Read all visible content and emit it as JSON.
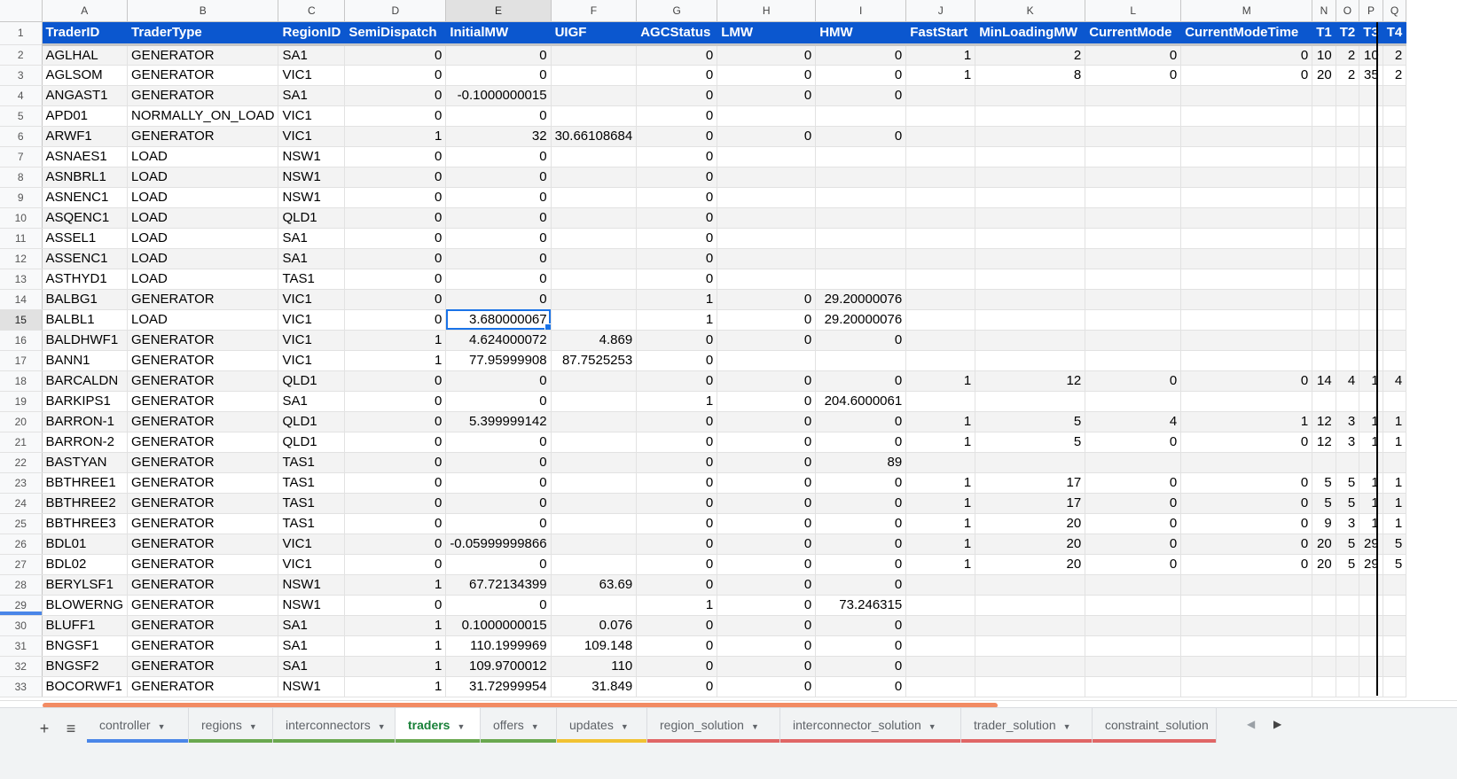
{
  "columns": {
    "letters": [
      "A",
      "B",
      "C",
      "D",
      "E",
      "F",
      "G",
      "H",
      "I",
      "J",
      "K",
      "L",
      "M",
      "N",
      "O",
      "P",
      "Q"
    ],
    "selected": "E"
  },
  "headers": [
    "TraderID",
    "TraderType",
    "RegionID",
    "SemiDispatch",
    "InitialMW",
    "UIGF",
    "AGCStatus",
    "LMW",
    "HMW",
    "FastStart",
    "MinLoadingMW",
    "CurrentMode",
    "CurrentModeTime",
    "T1",
    "T2",
    "T3",
    "T4"
  ],
  "header_row_number": "1",
  "rows": [
    {
      "num": "2",
      "cells": [
        "AGLHAL",
        "GENERATOR",
        "SA1",
        "0",
        "0",
        "",
        "0",
        "0",
        "0",
        "1",
        "2",
        "0",
        "0",
        "10",
        "2",
        "10",
        "2"
      ]
    },
    {
      "num": "3",
      "cells": [
        "AGLSOM",
        "GENERATOR",
        "VIC1",
        "0",
        "0",
        "",
        "0",
        "0",
        "0",
        "1",
        "8",
        "0",
        "0",
        "20",
        "2",
        "35",
        "2"
      ]
    },
    {
      "num": "4",
      "cells": [
        "ANGAST1",
        "GENERATOR",
        "SA1",
        "0",
        "-0.1000000015",
        "",
        "0",
        "0",
        "0",
        "",
        "",
        "",
        "",
        "",
        "",
        "",
        ""
      ]
    },
    {
      "num": "5",
      "cells": [
        "APD01",
        "NORMALLY_ON_LOAD",
        "VIC1",
        "0",
        "0",
        "",
        "0",
        "",
        "",
        "",
        "",
        "",
        "",
        "",
        "",
        "",
        ""
      ]
    },
    {
      "num": "6",
      "cells": [
        "ARWF1",
        "GENERATOR",
        "VIC1",
        "1",
        "32",
        "30.66108684",
        "0",
        "0",
        "0",
        "",
        "",
        "",
        "",
        "",
        "",
        "",
        ""
      ]
    },
    {
      "num": "7",
      "cells": [
        "ASNAES1",
        "LOAD",
        "NSW1",
        "0",
        "0",
        "",
        "0",
        "",
        "",
        "",
        "",
        "",
        "",
        "",
        "",
        "",
        ""
      ]
    },
    {
      "num": "8",
      "cells": [
        "ASNBRL1",
        "LOAD",
        "NSW1",
        "0",
        "0",
        "",
        "0",
        "",
        "",
        "",
        "",
        "",
        "",
        "",
        "",
        "",
        ""
      ]
    },
    {
      "num": "9",
      "cells": [
        "ASNENC1",
        "LOAD",
        "NSW1",
        "0",
        "0",
        "",
        "0",
        "",
        "",
        "",
        "",
        "",
        "",
        "",
        "",
        "",
        ""
      ]
    },
    {
      "num": "10",
      "cells": [
        "ASQENC1",
        "LOAD",
        "QLD1",
        "0",
        "0",
        "",
        "0",
        "",
        "",
        "",
        "",
        "",
        "",
        "",
        "",
        "",
        ""
      ]
    },
    {
      "num": "11",
      "cells": [
        "ASSEL1",
        "LOAD",
        "SA1",
        "0",
        "0",
        "",
        "0",
        "",
        "",
        "",
        "",
        "",
        "",
        "",
        "",
        "",
        ""
      ]
    },
    {
      "num": "12",
      "cells": [
        "ASSENC1",
        "LOAD",
        "SA1",
        "0",
        "0",
        "",
        "0",
        "",
        "",
        "",
        "",
        "",
        "",
        "",
        "",
        "",
        ""
      ]
    },
    {
      "num": "13",
      "cells": [
        "ASTHYD1",
        "LOAD",
        "TAS1",
        "0",
        "0",
        "",
        "0",
        "",
        "",
        "",
        "",
        "",
        "",
        "",
        "",
        "",
        ""
      ]
    },
    {
      "num": "14",
      "cells": [
        "BALBG1",
        "GENERATOR",
        "VIC1",
        "0",
        "0",
        "",
        "1",
        "0",
        "29.20000076",
        "",
        "",
        "",
        "",
        "",
        "",
        "",
        ""
      ]
    },
    {
      "num": "15",
      "cells": [
        "BALBL1",
        "LOAD",
        "VIC1",
        "0",
        "3.680000067",
        "",
        "1",
        "0",
        "29.20000076",
        "",
        "",
        "",
        "",
        "",
        "",
        "",
        ""
      ]
    },
    {
      "num": "16",
      "cells": [
        "BALDHWF1",
        "GENERATOR",
        "VIC1",
        "1",
        "4.624000072",
        "4.869",
        "0",
        "0",
        "0",
        "",
        "",
        "",
        "",
        "",
        "",
        "",
        ""
      ]
    },
    {
      "num": "17",
      "cells": [
        "BANN1",
        "GENERATOR",
        "VIC1",
        "1",
        "77.95999908",
        "87.7525253",
        "0",
        "",
        "",
        "",
        "",
        "",
        "",
        "",
        "",
        "",
        ""
      ]
    },
    {
      "num": "18",
      "cells": [
        "BARCALDN",
        "GENERATOR",
        "QLD1",
        "0",
        "0",
        "",
        "0",
        "0",
        "0",
        "1",
        "12",
        "0",
        "0",
        "14",
        "4",
        "1",
        "4"
      ]
    },
    {
      "num": "19",
      "cells": [
        "BARKIPS1",
        "GENERATOR",
        "SA1",
        "0",
        "0",
        "",
        "1",
        "0",
        "204.6000061",
        "",
        "",
        "",
        "",
        "",
        "",
        "",
        ""
      ]
    },
    {
      "num": "20",
      "cells": [
        "BARRON-1",
        "GENERATOR",
        "QLD1",
        "0",
        "5.399999142",
        "",
        "0",
        "0",
        "0",
        "1",
        "5",
        "4",
        "1",
        "12",
        "3",
        "1",
        "1"
      ]
    },
    {
      "num": "21",
      "cells": [
        "BARRON-2",
        "GENERATOR",
        "QLD1",
        "0",
        "0",
        "",
        "0",
        "0",
        "0",
        "1",
        "5",
        "0",
        "0",
        "12",
        "3",
        "1",
        "1"
      ]
    },
    {
      "num": "22",
      "cells": [
        "BASTYAN",
        "GENERATOR",
        "TAS1",
        "0",
        "0",
        "",
        "0",
        "0",
        "89",
        "",
        "",
        "",
        "",
        "",
        "",
        "",
        ""
      ]
    },
    {
      "num": "23",
      "cells": [
        "BBTHREE1",
        "GENERATOR",
        "TAS1",
        "0",
        "0",
        "",
        "0",
        "0",
        "0",
        "1",
        "17",
        "0",
        "0",
        "5",
        "5",
        "1",
        "1"
      ]
    },
    {
      "num": "24",
      "cells": [
        "BBTHREE2",
        "GENERATOR",
        "TAS1",
        "0",
        "0",
        "",
        "0",
        "0",
        "0",
        "1",
        "17",
        "0",
        "0",
        "5",
        "5",
        "1",
        "1"
      ]
    },
    {
      "num": "25",
      "cells": [
        "BBTHREE3",
        "GENERATOR",
        "TAS1",
        "0",
        "0",
        "",
        "0",
        "0",
        "0",
        "1",
        "20",
        "0",
        "0",
        "9",
        "3",
        "1",
        "1"
      ]
    },
    {
      "num": "26",
      "cells": [
        "BDL01",
        "GENERATOR",
        "VIC1",
        "0",
        "-0.05999999866",
        "",
        "0",
        "0",
        "0",
        "1",
        "20",
        "0",
        "0",
        "20",
        "5",
        "29",
        "5"
      ]
    },
    {
      "num": "27",
      "cells": [
        "BDL02",
        "GENERATOR",
        "VIC1",
        "0",
        "0",
        "",
        "0",
        "0",
        "0",
        "1",
        "20",
        "0",
        "0",
        "20",
        "5",
        "29",
        "5"
      ]
    },
    {
      "num": "28",
      "cells": [
        "BERYLSF1",
        "GENERATOR",
        "NSW1",
        "1",
        "67.72134399",
        "63.69",
        "0",
        "0",
        "0",
        "",
        "",
        "",
        "",
        "",
        "",
        "",
        ""
      ]
    },
    {
      "num": "29",
      "cells": [
        "BLOWERNG",
        "GENERATOR",
        "NSW1",
        "0",
        "0",
        "",
        "1",
        "0",
        "73.246315",
        "",
        "",
        "",
        "",
        "",
        "",
        "",
        ""
      ]
    },
    {
      "num": "30",
      "cells": [
        "BLUFF1",
        "GENERATOR",
        "SA1",
        "1",
        "0.1000000015",
        "0.076",
        "0",
        "0",
        "0",
        "",
        "",
        "",
        "",
        "",
        "",
        "",
        ""
      ]
    },
    {
      "num": "31",
      "cells": [
        "BNGSF1",
        "GENERATOR",
        "SA1",
        "1",
        "110.1999969",
        "109.148",
        "0",
        "0",
        "0",
        "",
        "",
        "",
        "",
        "",
        "",
        "",
        ""
      ]
    },
    {
      "num": "32",
      "cells": [
        "BNGSF2",
        "GENERATOR",
        "SA1",
        "1",
        "109.9700012",
        "110",
        "0",
        "0",
        "0",
        "",
        "",
        "",
        "",
        "",
        "",
        "",
        ""
      ]
    },
    {
      "num": "33",
      "cells": [
        "BOCORWF1",
        "GENERATOR",
        "NSW1",
        "1",
        "31.72999954",
        "31.849",
        "0",
        "0",
        "0",
        "",
        "",
        "",
        "",
        "",
        "",
        "",
        ""
      ]
    }
  ],
  "active_cell": {
    "row": "15",
    "col": "E"
  },
  "tabs": [
    {
      "label": "controller",
      "color": "#4a86e8",
      "active": false
    },
    {
      "label": "regions",
      "color": "#6aa84f",
      "active": false
    },
    {
      "label": "interconnectors",
      "color": "#6aa84f",
      "active": false
    },
    {
      "label": "traders",
      "color": "#6aa84f",
      "active": true
    },
    {
      "label": "offers",
      "color": "#6aa84f",
      "active": false
    },
    {
      "label": "updates",
      "color": "#f1c232",
      "active": false
    },
    {
      "label": "region_solution",
      "color": "#e06666",
      "active": false
    },
    {
      "label": "interconnector_solution",
      "color": "#e06666",
      "active": false
    },
    {
      "label": "trader_solution",
      "color": "#e06666",
      "active": false
    },
    {
      "label": "constraint_solution",
      "color": "#e06666",
      "active": false
    }
  ],
  "icons": {
    "add_sheet": "plus-icon",
    "all_sheets": "menu-icon",
    "tab_menu": "caret-down-icon",
    "scroll_left": "arrow-left-icon",
    "scroll_right": "arrow-right-icon"
  },
  "colors": {
    "header_bg": "#0b57cf",
    "header_text": "#ffffff",
    "active_tab_text": "#188038",
    "selection": "#1a73e8",
    "row_band": "#f3f3f3"
  }
}
